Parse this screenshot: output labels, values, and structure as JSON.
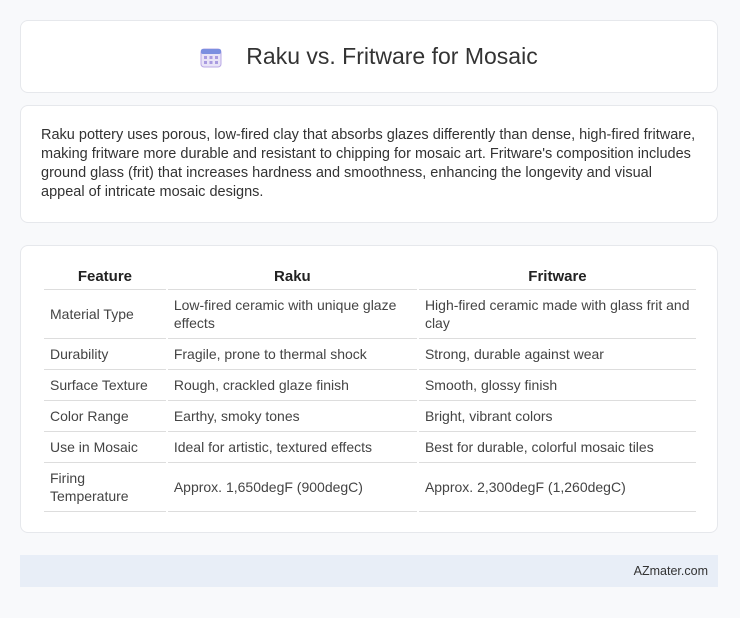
{
  "header": {
    "title": "Raku vs. Fritware for Mosaic",
    "icon": "calendar-icon"
  },
  "intro": {
    "text": "Raku pottery uses porous, low-fired clay that absorbs glazes differently than dense, high-fired fritware, making fritware more durable and resistant to chipping for mosaic art. Fritware's composition includes ground glass (frit) that increases hardness and smoothness, enhancing the longevity and visual appeal of intricate mosaic designs."
  },
  "table": {
    "headers": [
      "Feature",
      "Raku",
      "Fritware"
    ],
    "rows": [
      [
        "Material Type",
        "Low-fired ceramic with unique glaze effects",
        "High-fired ceramic made with glass frit and clay"
      ],
      [
        "Durability",
        "Fragile, prone to thermal shock",
        "Strong, durable against wear"
      ],
      [
        "Surface Texture",
        "Rough, crackled glaze finish",
        "Smooth, glossy finish"
      ],
      [
        "Color Range",
        "Earthy, smoky tones",
        "Bright, vibrant colors"
      ],
      [
        "Use in Mosaic",
        "Ideal for artistic, textured effects",
        "Best for durable, colorful mosaic tiles"
      ],
      [
        "Firing Temperature",
        "Approx. 1,650degF (900degC)",
        "Approx. 2,300degF (1,260degC)"
      ]
    ]
  },
  "footer": {
    "text": "AZmater.com"
  }
}
